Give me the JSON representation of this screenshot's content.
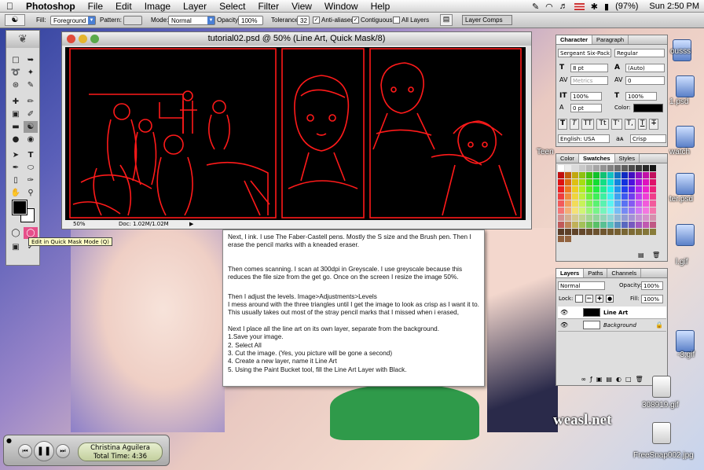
{
  "menubar": {
    "app": "Photoshop",
    "items": [
      "File",
      "Edit",
      "Image",
      "Layer",
      "Select",
      "Filter",
      "View",
      "Window",
      "Help"
    ],
    "battery": "(97%)",
    "clock": "Sun 2:50 PM"
  },
  "options": {
    "fill_label": "Fill:",
    "fill_value": "Foreground",
    "pattern_label": "Pattern:",
    "mode_label": "Mode:",
    "mode_value": "Normal",
    "opacity_label": "Opacity:",
    "opacity_value": "100%",
    "tolerance_label": "Tolerance:",
    "tolerance_value": "32",
    "antialiased": "Anti-aliased",
    "contiguous": "Contiguous",
    "all_layers": "All Layers",
    "layer_comps": "Layer Comps"
  },
  "document": {
    "title": "tutorial02.psd @ 50% (Line Art, Quick Mask/8)",
    "zoom": "50%",
    "doc_size": "Doc: 1.02M/1.02M",
    "mask_color": "#ff1a1a"
  },
  "tooltip": "Edit in Quick Mask Mode (Q)",
  "text_window": {
    "paragraphs": [
      "Next, I ink. I use The Faber-Castell pens. Mostly the S size and the Brush pen. Then I erase the pencil marks with a kneaded eraser.",
      "Then comes scanning. I scan at 300dpi in Greyscale. I use greyscale because this reduces the file size from the get go. Once on the screen I resize the image 50%.",
      "Then I adjust the levels.    Image>Adjustments>Levels\nI mess around with the three triangles until I get the image to look as crisp as I want it to. This usually takes out most of the stray pencil marks that I missed when i erased,",
      "Next I place all the line art on its own layer, separate from the background.\n1.Save your image.\n2. Select All\n3. Cut the image. (Yes, you picture will be gone a second)\n4. Create a new layer, name it Line Art\n5. Using the Paint Bucket tool, fill the Line Art Layer with Black."
    ]
  },
  "character_panel": {
    "tabs": [
      "Character",
      "Paragraph"
    ],
    "font": "Sergeant Six-Pack",
    "style": "Regular",
    "size": "8 pt",
    "leading": "(Auto)",
    "kerning": "Metrics",
    "tracking": "0",
    "vscale": "100%",
    "hscale": "100%",
    "baseline": "0 pt",
    "color_label": "Color:",
    "language": "English: USA",
    "aa_label": "aᴀ",
    "antialias": "Crisp",
    "style_buttons": [
      "T",
      "T",
      "TT",
      "Tt",
      "T'",
      "T,",
      "T",
      "T"
    ]
  },
  "swatches_panel": {
    "tabs": [
      "Color",
      "Swatches",
      "Styles"
    ],
    "active": "Swatches"
  },
  "layers_panel": {
    "tabs": [
      "Layers",
      "Paths",
      "Channels"
    ],
    "mode": "Normal",
    "opacity_label": "Opacity:",
    "opacity": "100%",
    "lock_label": "Lock:",
    "fill_label": "Fill:",
    "fill": "100%",
    "layers": [
      {
        "name": "Line Art",
        "thumb": "#000000"
      },
      {
        "name": "Background",
        "thumb": "#ffffff"
      }
    ]
  },
  "desktop": {
    "labels": [
      "ousss",
      "1.psd",
      "Teen",
      "watch",
      "ter.psd",
      "l.gif",
      "-3.gif",
      "308919.gif",
      "FreeSnap002.jpg"
    ],
    "watermark": "weasl.net"
  },
  "itunes": {
    "artist": "Christina Aguilera",
    "time": "Total Time: 4:36"
  }
}
